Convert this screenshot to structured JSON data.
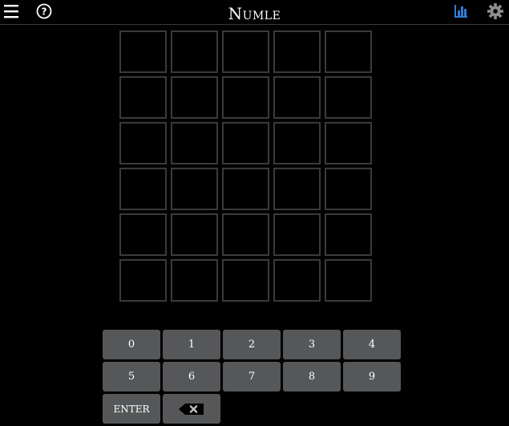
{
  "header": {
    "title": "Numle",
    "icons": [
      "menu-icon",
      "help-icon",
      "stats-icon",
      "gear-icon"
    ],
    "accent_color": "#2f7cd6"
  },
  "board": {
    "rows": 6,
    "cols": 5
  },
  "keyboard": {
    "row1": [
      "0",
      "1",
      "2",
      "3",
      "4"
    ],
    "row2": [
      "5",
      "6",
      "7",
      "8",
      "9"
    ],
    "enter_label": "ENTER",
    "backspace_icon": "backspace-icon"
  },
  "colors": {
    "background": "#000000",
    "tile_border": "#3a3a3c",
    "key_bg": "#565758"
  }
}
